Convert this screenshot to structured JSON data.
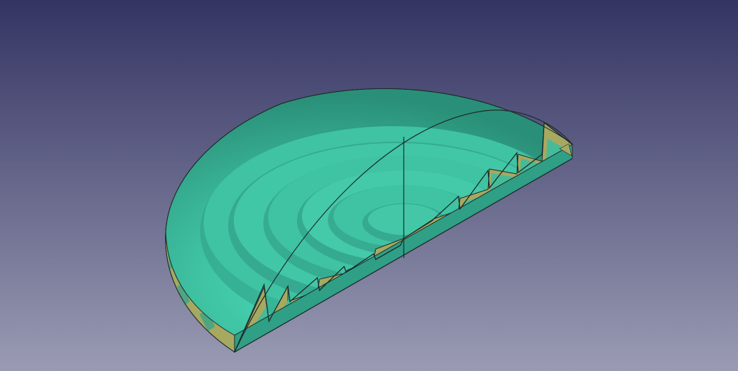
{
  "viewport": {
    "background_top_color": "#343463",
    "background_bottom_color": "#9a9bb3"
  },
  "model": {
    "shape": "sectioned-fresnel-dome",
    "body_color": "#3fc3a3",
    "body_highlight_color": "#48dcb8",
    "body_shadow_color": "#25816e",
    "section_face_color": "#a7a961",
    "edge_color": "#1c2a2a"
  }
}
